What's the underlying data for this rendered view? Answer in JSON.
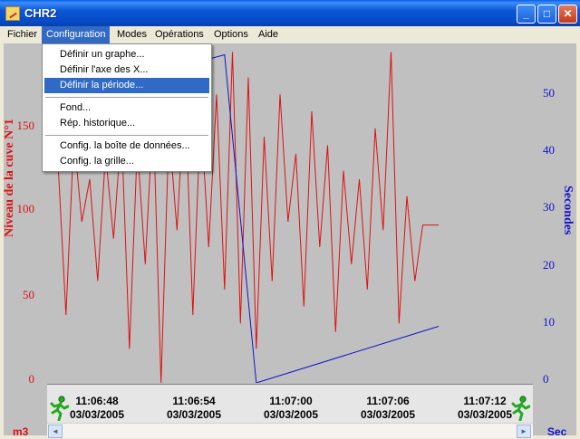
{
  "window": {
    "title": "CHR2"
  },
  "titlebar_buttons": {
    "minimize": "_",
    "maximize": "□",
    "close": "✕"
  },
  "menubar": {
    "items": [
      {
        "label": "Fichier"
      },
      {
        "label": "Configuration"
      },
      {
        "label": "Modes"
      },
      {
        "label": "Opérations"
      },
      {
        "label": "Options"
      },
      {
        "label": "Aide"
      }
    ],
    "active": "Configuration"
  },
  "configuration_menu": {
    "items": [
      {
        "label": "Définir un graphe..."
      },
      {
        "label": "Définir l'axe des X..."
      },
      {
        "label": "Définir la période...",
        "highlighted": true
      },
      {
        "label": "Fond..."
      },
      {
        "label": "Rép. historique..."
      },
      {
        "label": "Config. la boîte de données..."
      },
      {
        "label": "Config. la grille..."
      }
    ]
  },
  "left_axis": {
    "title": "Niveau de la cuve N°1",
    "unit": "m3",
    "ticks": [
      "150",
      "100",
      "50",
      "0"
    ],
    "color": "#dd1111"
  },
  "right_axis": {
    "title": "Secondes",
    "unit": "Sec",
    "ticks": [
      "50",
      "40",
      "30",
      "20",
      "10",
      "0"
    ],
    "color": "#1111cc"
  },
  "time_axis": {
    "labels": [
      {
        "time": "11:06:48",
        "date": "03/03/2005"
      },
      {
        "time": "11:06:54",
        "date": "03/03/2005"
      },
      {
        "time": "11:07:00",
        "date": "03/03/2005"
      },
      {
        "time": "11:07:06",
        "date": "03/03/2005"
      },
      {
        "time": "11:07:12",
        "date": "03/03/2005"
      }
    ]
  },
  "icons": {
    "runner_left": "running-man-icon",
    "runner_right": "running-man-icon",
    "scroll_left": "◄",
    "scroll_right": "►"
  },
  "chart_data": {
    "type": "line",
    "series": [
      {
        "name": "Niveau de la cuve N°1",
        "color": "#dd1111",
        "axis": "left",
        "x": [
          0,
          0.5,
          1,
          1.5,
          2,
          2.5,
          3,
          3.5,
          4,
          4.5,
          5,
          5.5,
          6,
          6.5,
          7,
          7.5,
          8,
          8.5,
          9,
          9.5,
          10,
          10.5,
          11,
          11.5,
          12,
          12.5,
          13,
          13.5,
          14,
          14.5,
          15,
          15.5,
          16,
          16.5,
          17,
          17.5,
          18,
          18.5,
          19,
          19.5,
          20,
          20.5,
          21,
          21.5,
          22,
          22.5,
          23,
          23.5,
          24
        ],
        "values": [
          130,
          40,
          145,
          95,
          120,
          60,
          135,
          85,
          150,
          20,
          140,
          70,
          160,
          0,
          150,
          90,
          175,
          40,
          160,
          80,
          170,
          55,
          195,
          35,
          180,
          20,
          145,
          60,
          170,
          95,
          135,
          45,
          160,
          80,
          140,
          30,
          125,
          70,
          120,
          55,
          150,
          90,
          195,
          35,
          110,
          60,
          93,
          93,
          93
        ],
        "ylim": [
          0,
          200
        ]
      },
      {
        "name": "Secondes",
        "color": "#1111cc",
        "axis": "right",
        "x": [
          0,
          10.5,
          12.5,
          24
        ],
        "values": [
          50,
          58,
          0,
          10
        ],
        "ylim": [
          0,
          60
        ]
      }
    ],
    "xlabels": [
      "11:06:48",
      "11:06:54",
      "11:07:00",
      "11:07:06",
      "11:07:12"
    ],
    "grid": false
  }
}
